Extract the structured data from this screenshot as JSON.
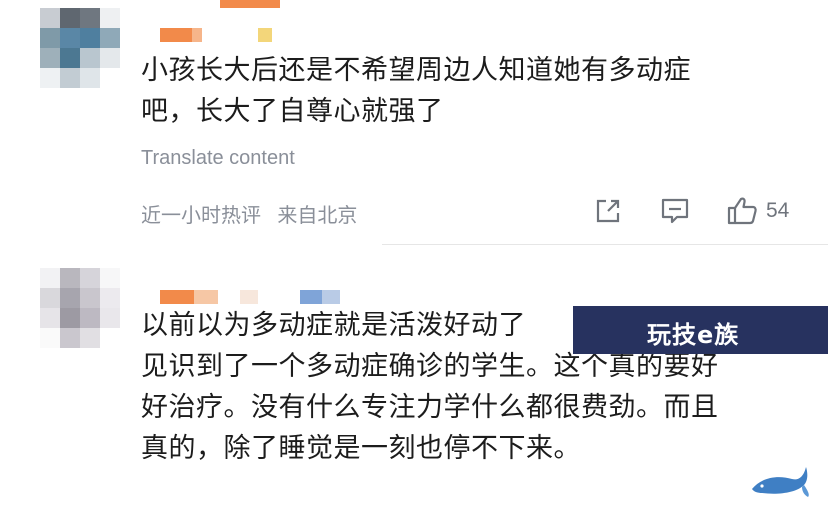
{
  "comments": [
    {
      "text_lines": [
        "小孩长大后还是不希望周边人知道她有多动症",
        "吧，长大了自尊心就强了"
      ],
      "translate_label": "Translate content",
      "meta": {
        "time": "近一小时热评",
        "location": "来自北京"
      },
      "actions": {
        "share_icon": "share-icon",
        "comment_icon": "comment-icon",
        "like_icon": "thumbs-up-icon",
        "like_count": "54"
      }
    },
    {
      "text_lines": [
        "以前以为多动症就是活泼好动了",
        "见识到了一个多动症确诊的学生。这个真的要好",
        "好治疗。没有什么专注力学什么都很费劲。而且",
        "真的，除了睡觉是一刻也停不下来。"
      ]
    }
  ],
  "watermark": {
    "text": "玩技e族",
    "logo_icon": "whale-icon",
    "color": "#27325f"
  },
  "colors": {
    "meta_gray": "#8a8f99",
    "text": "#1c1c1c",
    "highlight": "#fff7f0"
  }
}
